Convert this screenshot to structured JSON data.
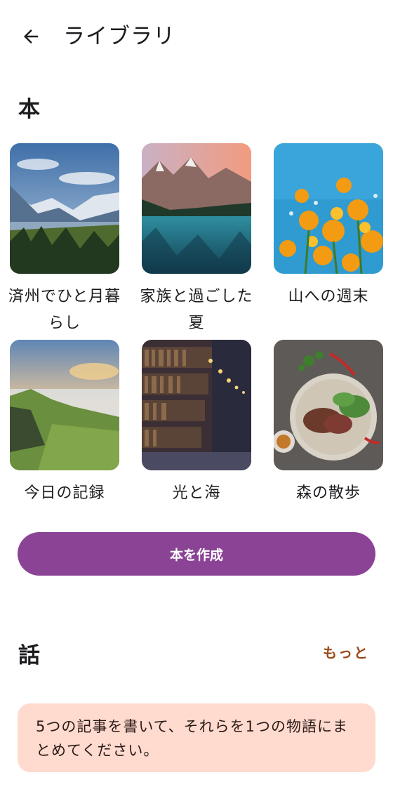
{
  "app_bar": {
    "title": "ライブラリ",
    "back_icon": "arrow-left-icon"
  },
  "books_section": {
    "heading": "本",
    "items": [
      {
        "title": "済州でひと月暮らし",
        "cover": "mountain-valley-photo"
      },
      {
        "title": "家族と過ごした夏",
        "cover": "mountain-lake-photo"
      },
      {
        "title": "山への週末",
        "cover": "yellow-flowers-photo"
      },
      {
        "title": "今日の記録",
        "cover": "cliff-sunset-photo"
      },
      {
        "title": "光と海",
        "cover": "library-shelves-photo"
      },
      {
        "title": "森の散歩",
        "cover": "steak-salad-photo"
      }
    ],
    "create_button": "本を作成"
  },
  "stories_section": {
    "heading": "話",
    "more_link": "もっと",
    "prompt": "5つの記事を書いて、それらを1つの物語にまとめてください。"
  },
  "colors": {
    "accent": "#8a4395",
    "link": "#9a4a1a",
    "card_bg": "#ffdacf"
  }
}
